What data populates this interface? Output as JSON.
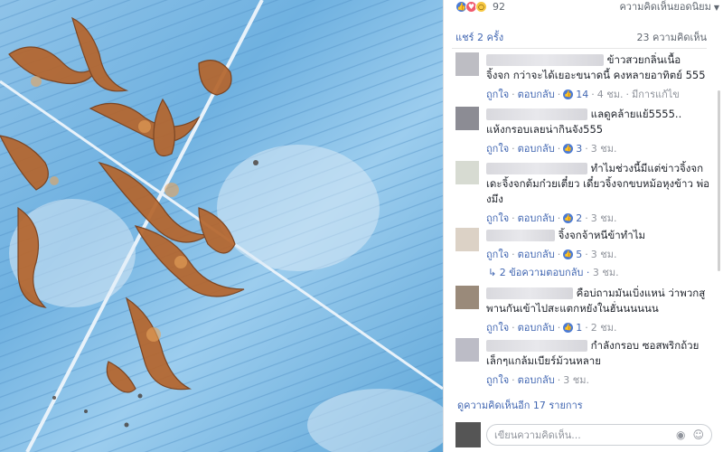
{
  "reactions": {
    "count": "92",
    "sort_label": "ความคิดเห็นยอดนิยม",
    "icons": [
      "like-icon",
      "love-icon",
      "wow-icon"
    ]
  },
  "stats": {
    "shares": "แชร์ 2 ครั้ง",
    "comments": "23 ความคิดเห็น"
  },
  "comments": [
    {
      "line1": "ข้าวสวยกลิ่นเนื้อ",
      "line2": "จิ้งจก กว่าจะได้เยอะขนาดนี้ คงหลายอาทิตย์ 555",
      "like": "ถูกใจ",
      "reply": "ตอบกลับ",
      "count": "14",
      "time": "4 ชม.",
      "extra": "มีการแก้ไข"
    },
    {
      "line1": "แลดูคล้ายแย้5555..",
      "line2": "แห้งกรอบเลยน่ากินจัง555",
      "like": "ถูกใจ",
      "reply": "ตอบกลับ",
      "count": "3",
      "time": "3 ชม."
    },
    {
      "line1": "ทำไมช่วงนี้มีแต่ข่าวจิ้งจก",
      "line2": "เดะจิ้งจกต้มก๋วยเตี๋ยว เดี๋ยวจิ้งจกขบหม้อหุงข้าว พ่อ",
      "line3": "งมึง",
      "like": "ถูกใจ",
      "reply": "ตอบกลับ",
      "count": "2",
      "time": "3 ชม."
    },
    {
      "line1": "จิ้งจกจ้าหนีข้าทำไม",
      "like": "ถูกใจ",
      "reply": "ตอบกลับ",
      "count": "5",
      "time": "3 ชม."
    },
    {
      "line1": "คือบ่ถามมันเบิ่งแหน่ ว่าพวกสู",
      "line2": "พานกันเข้าไปสะแตกหยังในฮั่นนนนนน",
      "like": "ถูกใจ",
      "reply": "ตอบกลับ",
      "count": "1",
      "time": "2 ชม."
    },
    {
      "line1": "กำลังกรอบ ซอสพริกถ้วย",
      "line2": "เล็กๆแกล้มเบียร์ม้วนหลาย",
      "like": "ถูกใจ",
      "reply": "ตอบกลับ",
      "time": "3 ชม."
    }
  ],
  "replies": {
    "label": "2 ข้อความตอบกลับ",
    "time": "3 ชม."
  },
  "more_comments": "ดูความคิดเห็นอีก 17 รายการ",
  "compose": {
    "placeholder": "เขียนความคิดเห็น..."
  }
}
